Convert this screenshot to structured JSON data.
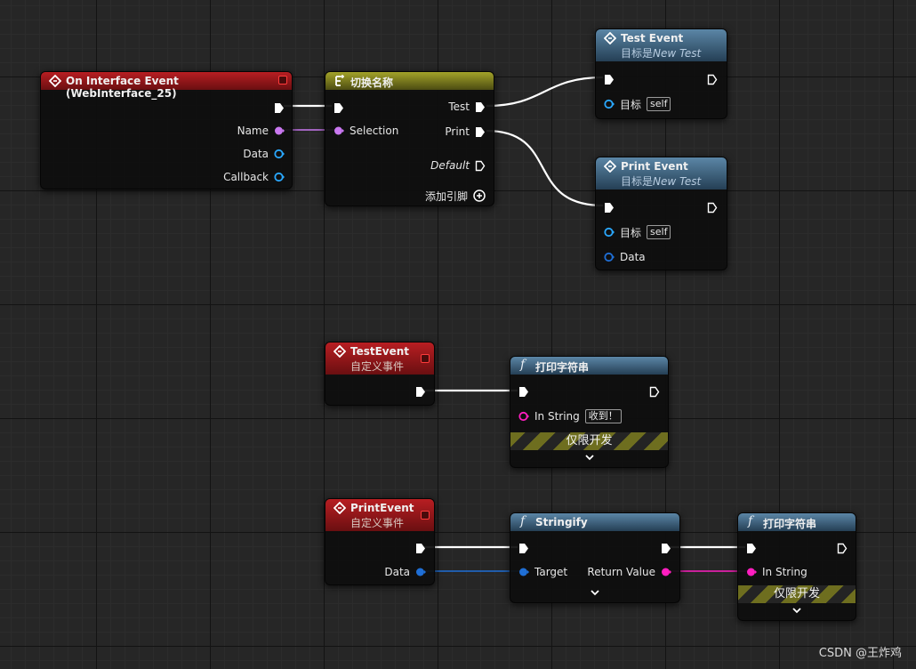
{
  "nodes": {
    "on_interface_event": {
      "title": "On Interface Event (WebInterface_25)",
      "pins": {
        "name": "Name",
        "data": "Data",
        "callback": "Callback"
      }
    },
    "switch_on_name": {
      "title": "切换名称",
      "pins": {
        "selection": "Selection",
        "test": "Test",
        "print": "Print",
        "default": "Default",
        "add_pin": "添加引脚"
      }
    },
    "test_event_call": {
      "title": "Test Event",
      "subtitle_prefix": "目标是",
      "subtitle_target": "New Test",
      "pins": {
        "target": "目标",
        "target_value": "self"
      }
    },
    "print_event_call": {
      "title": "Print Event",
      "subtitle_prefix": "目标是",
      "subtitle_target": "New Test",
      "pins": {
        "target": "目标",
        "target_value": "self",
        "data": "Data"
      }
    },
    "test_event_custom": {
      "title": "TestEvent",
      "subtitle": "自定义事件"
    },
    "print_string_1": {
      "title": "打印字符串",
      "pins": {
        "in_string": "In String",
        "in_string_value": "收到！"
      },
      "dev_only": "仅限开发"
    },
    "print_event_custom": {
      "title": "PrintEvent",
      "subtitle": "自定义事件",
      "pins": {
        "data": "Data"
      }
    },
    "stringify": {
      "title": "Stringify",
      "pins": {
        "target": "Target",
        "return_value": "Return Value"
      }
    },
    "print_string_2": {
      "title": "打印字符串",
      "pins": {
        "in_string": "In String"
      },
      "dev_only": "仅限开发"
    }
  },
  "colors": {
    "event_header": "#b81e22",
    "function_header": "#5b86a6",
    "switch_header": "#a3a329",
    "string_pin": "#c978f0",
    "object_pin": "#2aa8ff",
    "strstring_pin": "#ff1ec0",
    "struct_pin": "#1f6fd6",
    "exec_wire": "#ffffff"
  },
  "watermark": "CSDN @王炸鸡"
}
